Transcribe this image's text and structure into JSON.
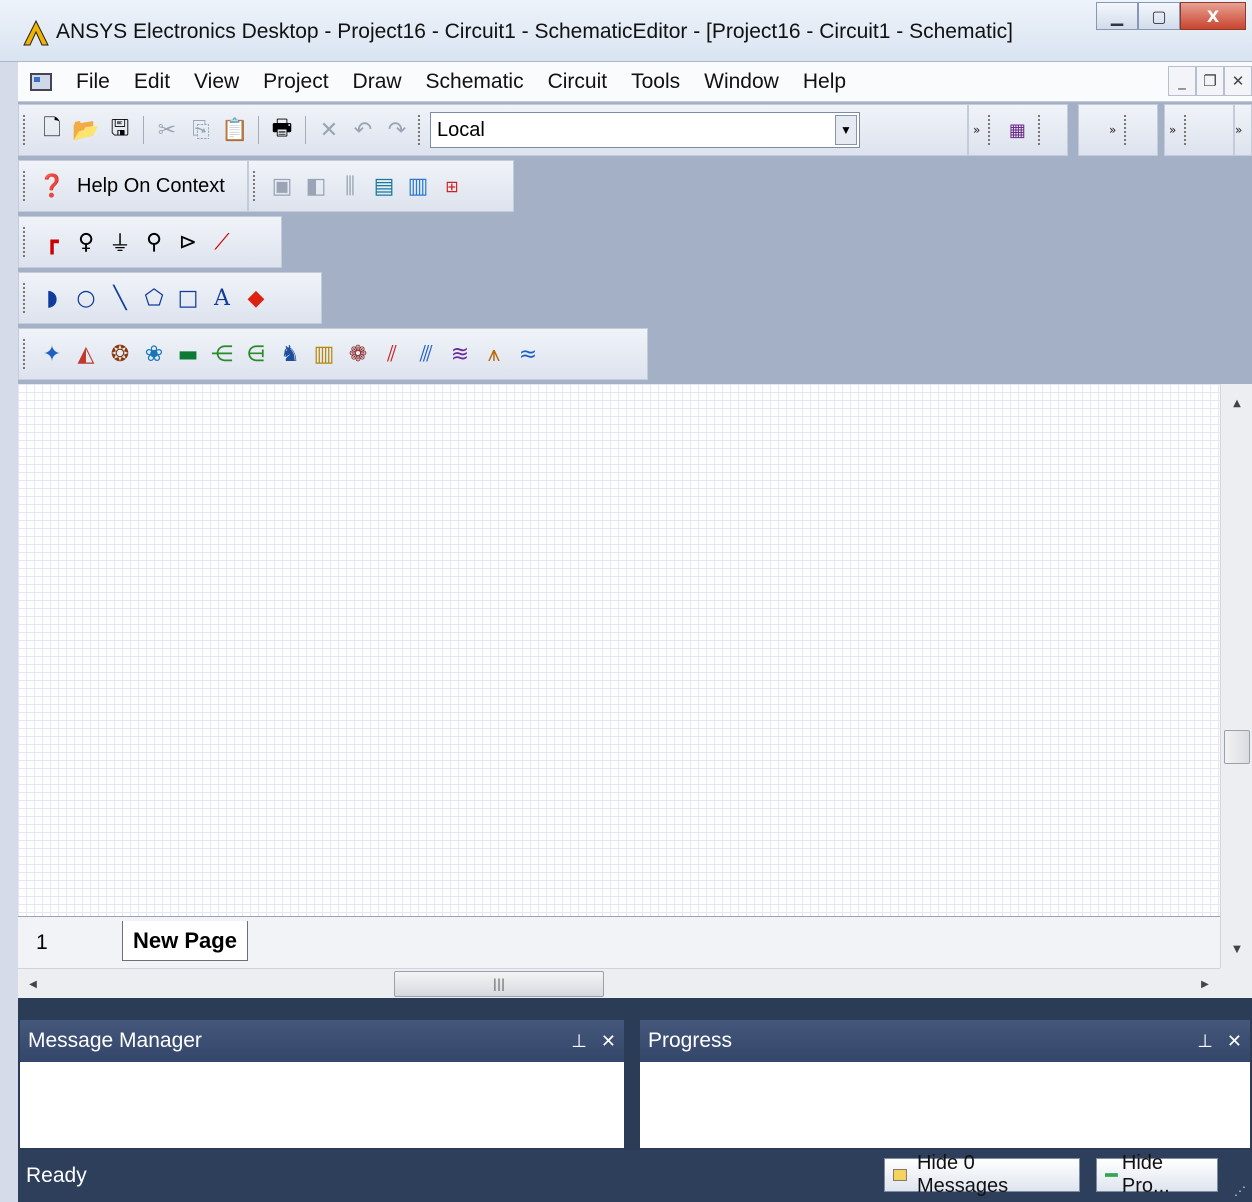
{
  "window": {
    "title": "ANSYS Electronics Desktop - Project16 - Circuit1 - SchematicEditor - [Project16 - Circuit1 - Schematic]",
    "logo_color": "#f2b300"
  },
  "menubar": {
    "items": [
      "File",
      "Edit",
      "View",
      "Project",
      "Draw",
      "Schematic",
      "Circuit",
      "Tools",
      "Window",
      "Help"
    ]
  },
  "toolbar": {
    "machine_select": {
      "value": "Local"
    },
    "help_on_context_label": "Help On Context"
  },
  "canvas": {
    "page_number": "1",
    "tabs": [
      "New Page"
    ]
  },
  "panels": {
    "message_manager_title": "Message Manager",
    "progress_title": "Progress"
  },
  "statusbar": {
    "status": "Ready",
    "hide_messages_label": "Hide 0 Messages",
    "hide_progress_label": "Hide Pro..."
  },
  "colors": {
    "accent": "#2e3f5c",
    "toolbar_bg": "#a3b0c6",
    "grid": "#c7cff0"
  }
}
